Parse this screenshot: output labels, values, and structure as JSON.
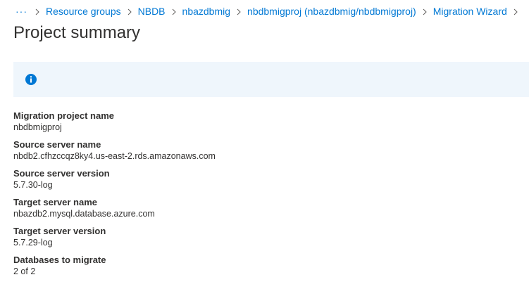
{
  "breadcrumb": {
    "ellipsis": "···",
    "items": [
      {
        "label": "Resource groups"
      },
      {
        "label": "NBDB"
      },
      {
        "label": "nbazdbmig"
      },
      {
        "label": "nbdbmigproj (nbazdbmig/nbdbmigproj)"
      },
      {
        "label": "Migration Wizard"
      }
    ]
  },
  "page": {
    "title": "Project summary"
  },
  "info_bar": {
    "icon": "info-icon",
    "message": ""
  },
  "summary": [
    {
      "label": "Migration project name",
      "value": "nbdbmigproj"
    },
    {
      "label": "Source server name",
      "value": "nbdb2.cfhzccqz8ky4.us-east-2.rds.amazonaws.com"
    },
    {
      "label": "Source server version",
      "value": "5.7.30-log"
    },
    {
      "label": "Target server name",
      "value": "nbazdb2.mysql.database.azure.com"
    },
    {
      "label": "Target server version",
      "value": "5.7.29-log"
    },
    {
      "label": "Databases to migrate",
      "value": "2 of 2"
    }
  ],
  "colors": {
    "link": "#0078d4",
    "info_background": "#eff6fc",
    "info_icon": "#0078d4",
    "text": "#323130"
  }
}
